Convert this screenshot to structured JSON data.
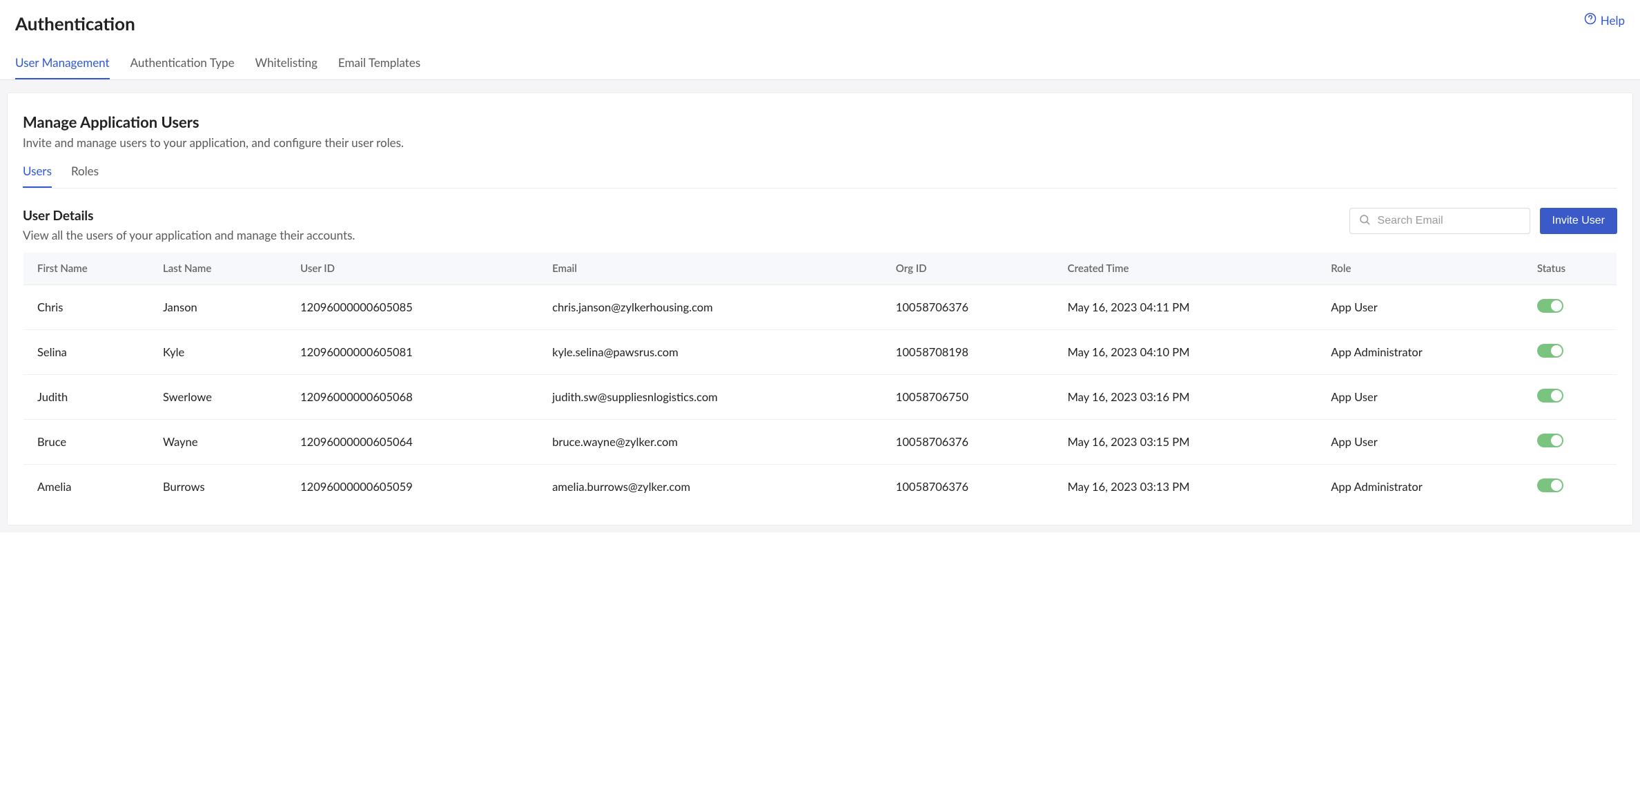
{
  "header": {
    "title": "Authentication",
    "help_label": "Help"
  },
  "top_tabs": [
    {
      "label": "User Management",
      "active": true
    },
    {
      "label": "Authentication Type",
      "active": false
    },
    {
      "label": "Whitelisting",
      "active": false
    },
    {
      "label": "Email Templates",
      "active": false
    }
  ],
  "section": {
    "title": "Manage Application Users",
    "desc": "Invite and manage users to your application, and configure their user roles."
  },
  "sub_tabs": [
    {
      "label": "Users",
      "active": true
    },
    {
      "label": "Roles",
      "active": false
    }
  ],
  "details": {
    "title": "User Details",
    "desc": "View all the users of your application and manage their accounts."
  },
  "search": {
    "placeholder": "Search Email"
  },
  "invite_button": "Invite User",
  "table": {
    "columns": [
      "First Name",
      "Last Name",
      "User ID",
      "Email",
      "Org ID",
      "Created Time",
      "Role",
      "Status"
    ],
    "rows": [
      {
        "first": "Chris",
        "last": "Janson",
        "user_id": "12096000000605085",
        "email": "chris.janson@zylkerhousing.com",
        "org_id": "10058706376",
        "created": "May 16, 2023 04:11 PM",
        "role": "App User",
        "status": true
      },
      {
        "first": "Selina",
        "last": "Kyle",
        "user_id": "12096000000605081",
        "email": "kyle.selina@pawsrus.com",
        "org_id": "10058708198",
        "created": "May 16, 2023 04:10 PM",
        "role": "App Administrator",
        "status": true
      },
      {
        "first": "Judith",
        "last": "Swerlowe",
        "user_id": "12096000000605068",
        "email": "judith.sw@suppliesnlogistics.com",
        "org_id": "10058706750",
        "created": "May 16, 2023 03:16 PM",
        "role": "App User",
        "status": true
      },
      {
        "first": "Bruce",
        "last": "Wayne",
        "user_id": "12096000000605064",
        "email": "bruce.wayne@zylker.com",
        "org_id": "10058706376",
        "created": "May 16, 2023 03:15 PM",
        "role": "App User",
        "status": true
      },
      {
        "first": "Amelia",
        "last": "Burrows",
        "user_id": "12096000000605059",
        "email": "amelia.burrows@zylker.com",
        "org_id": "10058706376",
        "created": "May 16, 2023 03:13 PM",
        "role": "App Administrator",
        "status": true
      }
    ]
  }
}
